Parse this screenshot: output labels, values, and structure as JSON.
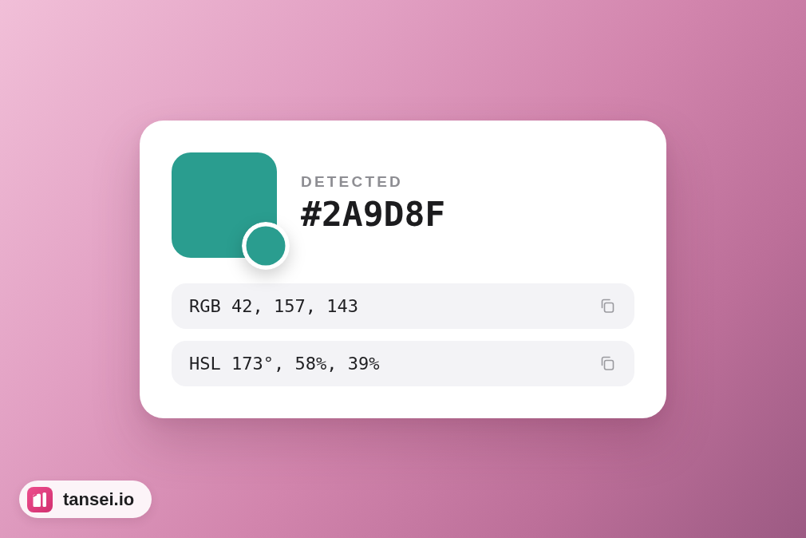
{
  "color_card": {
    "swatch": {
      "color": "#2a9d8f"
    },
    "label": "DETECTED",
    "hex": "#2A9D8F",
    "values": [
      {
        "text": "RGB 42, 157, 143"
      },
      {
        "text": "HSL 173°, 58%, 39%"
      }
    ]
  },
  "brand_badge": {
    "name": "tansei.io"
  }
}
